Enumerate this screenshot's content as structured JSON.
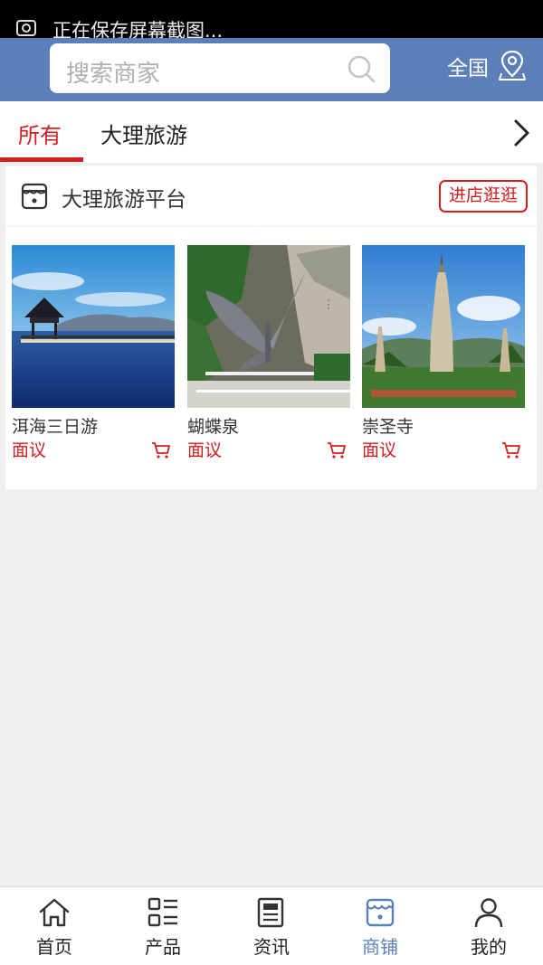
{
  "status": {
    "text": "正在保存屏幕截图..."
  },
  "search": {
    "placeholder": "搜索商家"
  },
  "header": {
    "region_label": "全国"
  },
  "tabs": [
    {
      "label": "所有"
    },
    {
      "label": "大理旅游"
    }
  ],
  "shop": {
    "name": "大理旅游平台",
    "enter_label": "进店逛逛",
    "products": [
      {
        "name": "洱海三日游",
        "price": "面议"
      },
      {
        "name": "蝴蝶泉",
        "price": "面议"
      },
      {
        "name": "崇圣寺",
        "price": "面议"
      }
    ]
  },
  "bottom_nav": [
    {
      "label": "首页",
      "icon": "home-icon"
    },
    {
      "label": "产品",
      "icon": "grid-list-icon"
    },
    {
      "label": "资讯",
      "icon": "news-icon"
    },
    {
      "label": "商铺",
      "icon": "store-icon"
    },
    {
      "label": "我的",
      "icon": "user-icon"
    }
  ],
  "colors": {
    "header": "#5b7fb8",
    "accent": "#d41e1e",
    "active_nav": "#5b7fb8"
  }
}
